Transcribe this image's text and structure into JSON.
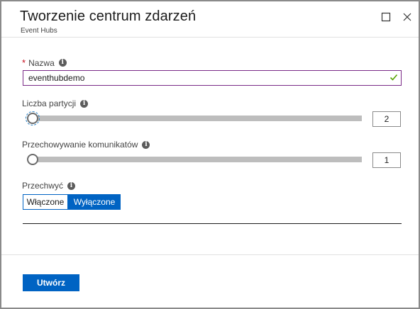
{
  "header": {
    "title": "Tworzenie centrum zdarzeń",
    "subtitle": "Event Hubs",
    "maximize_icon": "maximize-icon",
    "close_icon": "close-icon"
  },
  "name_field": {
    "label": "Nazwa",
    "required_mark": "*",
    "value": "eventhubdemo",
    "valid_icon": "checkmark-icon"
  },
  "partitions": {
    "label": "Liczba partycji",
    "value": "2"
  },
  "retention": {
    "label": "Przechowywanie komunikatów",
    "value": "1"
  },
  "capture": {
    "label": "Przechwyć",
    "options": [
      "Włączone",
      "Wyłączone"
    ],
    "selected": "Wyłączone"
  },
  "footer": {
    "create_label": "Utwórz"
  },
  "colors": {
    "accent": "#0063c3",
    "required": "#c50f1f",
    "valid": "#57a300",
    "input_focus_border": "#7a2a87"
  }
}
